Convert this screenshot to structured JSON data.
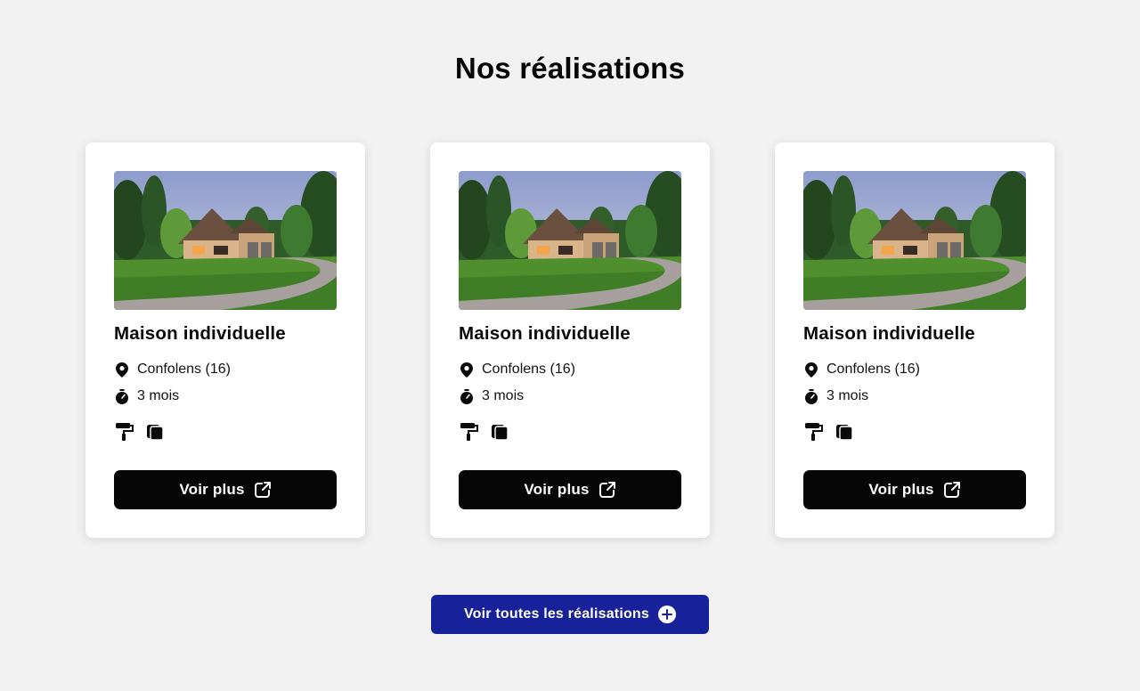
{
  "section": {
    "title": "Nos réalisations"
  },
  "projects": [
    {
      "title": "Maison individuelle",
      "location": "Confolens (16)",
      "duration": "3 mois",
      "image_icon": "house-photo",
      "services": [
        "paint-roller-icon",
        "layers-icon"
      ],
      "button_label": "Voir plus",
      "button_icon": "external-link-icon"
    },
    {
      "title": "Maison individuelle",
      "location": "Confolens (16)",
      "duration": "3 mois",
      "image_icon": "house-photo",
      "services": [
        "paint-roller-icon",
        "layers-icon"
      ],
      "button_label": "Voir plus",
      "button_icon": "external-link-icon"
    },
    {
      "title": "Maison individuelle",
      "location": "Confolens (16)",
      "duration": "3 mois",
      "image_icon": "house-photo",
      "services": [
        "paint-roller-icon",
        "layers-icon"
      ],
      "button_label": "Voir plus",
      "button_icon": "external-link-icon"
    }
  ],
  "all_button": {
    "label": "Voir toutes les réalisations",
    "icon": "plus-circle-icon"
  },
  "colors": {
    "background": "#f2f2f2",
    "card": "#ffffff",
    "card_button": "#060606",
    "all_button": "#17229a",
    "text": "#0a0a0a"
  }
}
